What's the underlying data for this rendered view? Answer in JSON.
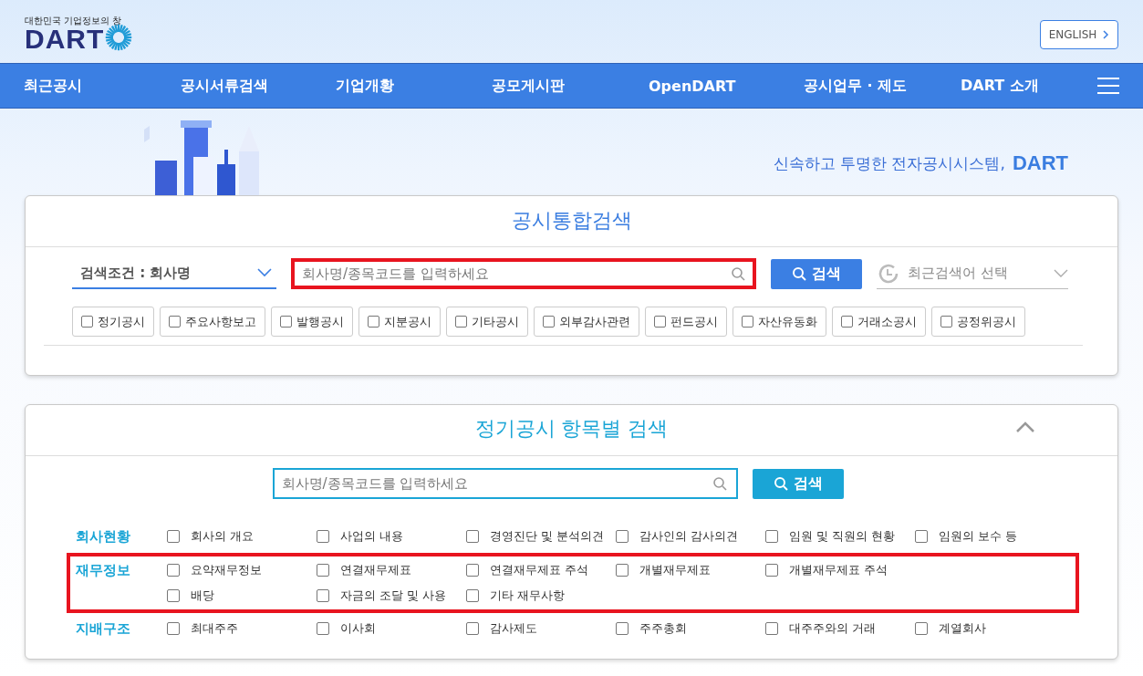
{
  "header": {
    "logo_tagline": "대한민국 기업정보의 창",
    "logo_text": "DART",
    "language_button": "ENGLISH"
  },
  "nav": {
    "items": [
      "최근공시",
      "공시서류검색",
      "기업개황",
      "공모게시판",
      "OpenDART",
      "공시업무 · 제도",
      "DART 소개"
    ]
  },
  "banner": {
    "slogan": "신속하고 투명한 전자공시시스템,",
    "slogan_brand": "DART"
  },
  "integrated_search": {
    "title": "공시통합검색",
    "condition": "검색조건 : 회사명",
    "search": {
      "placeholder": "회사명/종목코드를 입력하세요",
      "highlighted": true
    },
    "search_button": "검색",
    "recent": "최근검색어 선택",
    "filters": [
      {
        "label": "정기공시",
        "checked": false
      },
      {
        "label": "주요사항보고",
        "checked": false
      },
      {
        "label": "발행공시",
        "checked": false
      },
      {
        "label": "지분공시",
        "checked": false
      },
      {
        "label": "기타공시",
        "checked": false
      },
      {
        "label": "외부감사관련",
        "checked": false
      },
      {
        "label": "펀드공시",
        "checked": false
      },
      {
        "label": "자산유동화",
        "checked": false
      },
      {
        "label": "거래소공시",
        "checked": false
      },
      {
        "label": "공정위공시",
        "checked": false
      }
    ]
  },
  "periodic_search": {
    "title": "정기공시 항목별 검색",
    "expanded": true,
    "search": {
      "placeholder": "회사명/종목코드를 입력하세요",
      "highlighted": false
    },
    "search_button": "검색",
    "categories": [
      {
        "name": "회사현황",
        "highlighted": false,
        "rows": [
          [
            {
              "label": "회사의 개요",
              "checked": false
            },
            {
              "label": "사업의 내용",
              "checked": false
            },
            {
              "label": "경영진단 및 분석의견",
              "checked": false
            },
            {
              "label": "감사인의 감사의견",
              "checked": false
            },
            {
              "label": "임원 및 직원의 현황",
              "checked": false
            },
            {
              "label": "임원의 보수 등",
              "checked": false
            }
          ]
        ]
      },
      {
        "name": "재무정보",
        "highlighted": true,
        "rows": [
          [
            {
              "label": "요약재무정보",
              "checked": false
            },
            {
              "label": "연결재무제표",
              "checked": false
            },
            {
              "label": "연결재무제표 주석",
              "checked": false
            },
            {
              "label": "개별재무제표",
              "checked": false
            },
            {
              "label": "개별재무제표 주석",
              "checked": false
            }
          ],
          [
            {
              "label": "배당",
              "checked": false
            },
            {
              "label": "자금의 조달 및 사용",
              "checked": false
            },
            {
              "label": "기타 재무사항",
              "checked": false
            }
          ]
        ]
      },
      {
        "name": "지배구조",
        "highlighted": false,
        "rows": [
          [
            {
              "label": "최대주주",
              "checked": false
            },
            {
              "label": "이사회",
              "checked": false
            },
            {
              "label": "감사제도",
              "checked": false
            },
            {
              "label": "주주총회",
              "checked": false
            },
            {
              "label": "대주주와의 거래",
              "checked": false
            },
            {
              "label": "계열회사",
              "checked": false
            }
          ]
        ]
      }
    ]
  }
}
